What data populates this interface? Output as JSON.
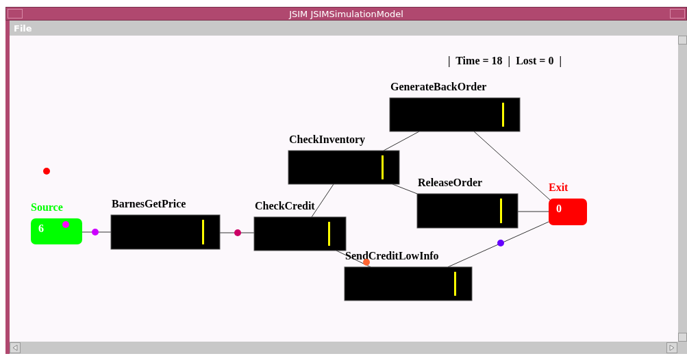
{
  "window": {
    "title": "JSIM JSIMSimulationModel"
  },
  "menu": [
    "File"
  ],
  "status": "|  Time = 18  |  Lost = 0  |",
  "nodes": [
    {
      "kind": "source",
      "label": "Source",
      "count": "6"
    },
    {
      "kind": "server",
      "label": "BarnesGetPrice"
    },
    {
      "kind": "server",
      "label": "CheckCredit"
    },
    {
      "kind": "server",
      "label": "CheckInventory"
    },
    {
      "kind": "server",
      "label": "GenerateBackOrder"
    },
    {
      "kind": "server",
      "label": "ReleaseOrder"
    },
    {
      "kind": "server",
      "label": "SendCreditLowInfo"
    },
    {
      "kind": "sink",
      "label": "Exit",
      "count": "0"
    }
  ],
  "entities": [
    {
      "color": "#ff0000"
    },
    {
      "color": "#ff00ff"
    },
    {
      "color": "#cc00ff"
    },
    {
      "color": "#cc0066"
    },
    {
      "color": "#ff6633"
    },
    {
      "color": "#6600ff"
    }
  ]
}
